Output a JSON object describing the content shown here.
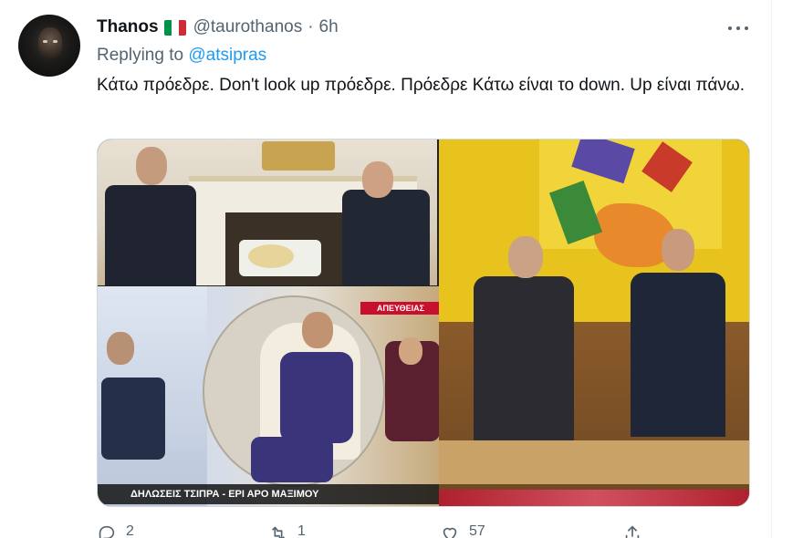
{
  "tweet": {
    "display_name": "Thanos",
    "flag_emoji": "🇮🇹",
    "flag_colors": [
      "#009246",
      "#ffffff",
      "#ce2b37"
    ],
    "handle": "@taurothanos",
    "separator": "·",
    "time": "6h",
    "reply_prefix": "Replying to ",
    "reply_to": "@atsipras",
    "text": "Κάτω πρόεδρε. Don't look up πρόεδρε. Πρόεδρε Κάτω είναι το down.  Up είναι πάνω."
  },
  "media": {
    "tv_badge_live": "ΑΠΕΥΘΕΙΑΣ",
    "tv_ticker": "ΔΗΛΩΣΕΙΣ ΤΣΙΠΡΑ - ΕΡΙ          ΑΡΟ ΜΑΞΙΜΟΥ"
  },
  "actions": {
    "reply_count": "2",
    "retweet_count": "1",
    "like_count": "57"
  },
  "colors": {
    "link": "#1d9bf0",
    "muted": "#536471",
    "text": "#0f1419"
  },
  "icons": {
    "more": "more-horizontal-icon",
    "reply": "reply-icon",
    "retweet": "retweet-icon",
    "like": "heart-icon",
    "share": "share-icon"
  }
}
